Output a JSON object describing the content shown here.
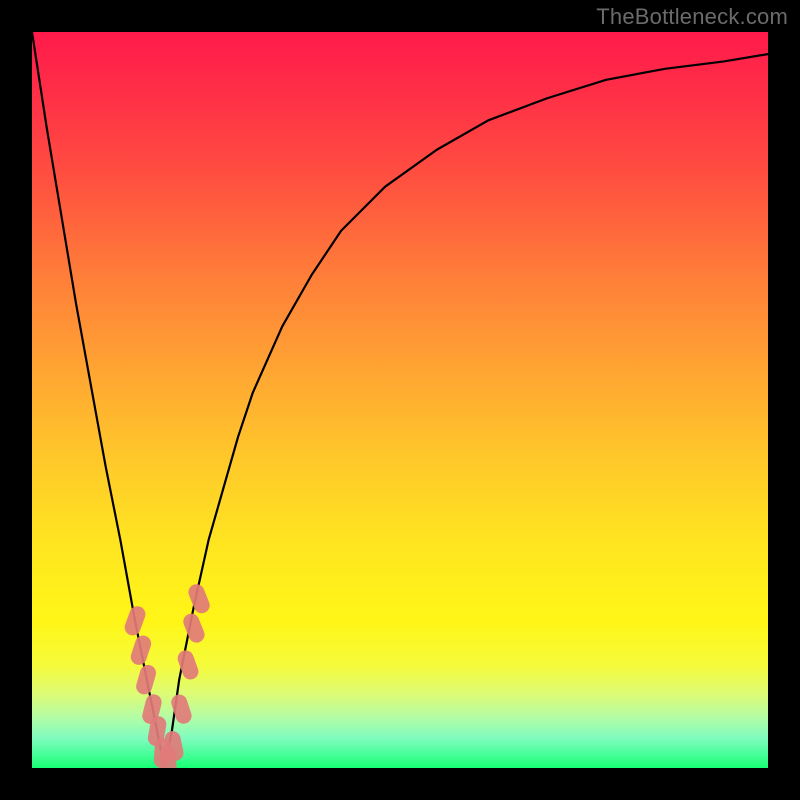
{
  "watermark": "TheBottleneck.com",
  "chart_data": {
    "type": "line",
    "title": "",
    "xlabel": "",
    "ylabel": "",
    "xlim": [
      0,
      100
    ],
    "ylim": [
      0,
      100
    ],
    "grid": false,
    "legend": false,
    "gradient_colors_top_to_bottom": [
      "#ff1a4b",
      "#ff5040",
      "#ffa233",
      "#ffe620",
      "#f6fb3a",
      "#7efcbf",
      "#17ff75"
    ],
    "curve_min_x": 18,
    "series": [
      {
        "name": "bottleneck-curve",
        "x": [
          0,
          2,
          4,
          6,
          8,
          10,
          12,
          14,
          16,
          17,
          18,
          19,
          20,
          22,
          24,
          26,
          28,
          30,
          34,
          38,
          42,
          48,
          55,
          62,
          70,
          78,
          86,
          94,
          100
        ],
        "y": [
          100,
          87,
          75,
          63,
          52,
          41,
          31,
          20,
          10,
          5,
          0,
          5,
          12,
          22,
          31,
          38,
          45,
          51,
          60,
          67,
          73,
          79,
          84,
          88,
          91,
          93.5,
          95,
          96,
          97
        ]
      }
    ],
    "highlight_points": {
      "name": "emphasis-lozenges",
      "color": "#e17b7a",
      "points": [
        {
          "x": 14.0,
          "y": 20,
          "rot": 20
        },
        {
          "x": 14.8,
          "y": 16,
          "rot": 18
        },
        {
          "x": 15.5,
          "y": 12,
          "rot": 16
        },
        {
          "x": 16.3,
          "y": 8,
          "rot": 14
        },
        {
          "x": 17.0,
          "y": 5,
          "rot": 10
        },
        {
          "x": 17.7,
          "y": 2,
          "rot": 4
        },
        {
          "x": 18.5,
          "y": 1,
          "rot": -4
        },
        {
          "x": 19.3,
          "y": 3,
          "rot": -12
        },
        {
          "x": 20.3,
          "y": 8,
          "rot": -18
        },
        {
          "x": 21.2,
          "y": 14,
          "rot": -20
        },
        {
          "x": 22.0,
          "y": 19,
          "rot": -22
        },
        {
          "x": 22.7,
          "y": 23,
          "rot": -22
        }
      ]
    }
  }
}
